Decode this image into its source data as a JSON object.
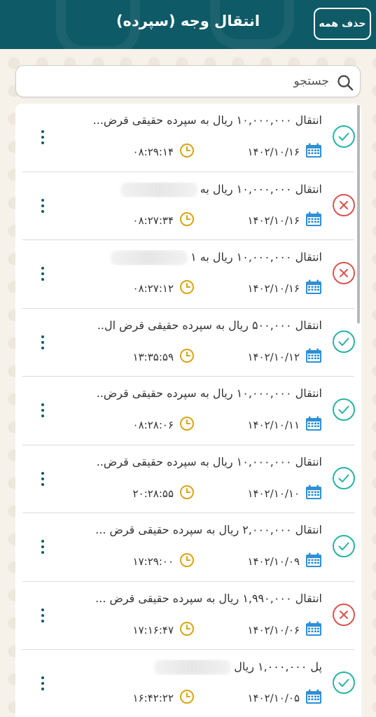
{
  "header": {
    "title": "انتقال وجه (سپرده)",
    "clear_all_label": "حذف همه"
  },
  "search": {
    "placeholder": "جستجو",
    "value": ""
  },
  "colors": {
    "header_bg": "#0e5a66",
    "success": "#27b3a4",
    "failure": "#d9534f",
    "calendar_icon": "#2f8fd6",
    "clock_icon": "#d9a514"
  },
  "transactions": [
    {
      "status": "success",
      "title": "انتقال ۱۰,۰۰۰,۰۰۰ ریال به سپرده حقیقی قرض...",
      "masked": false,
      "date": "۱۴۰۲/۱۰/۱۶",
      "time": "۰۸:۲۹:۱۴"
    },
    {
      "status": "failure",
      "title": "انتقال ۱۰,۰۰۰,۰۰۰ ریال به",
      "masked": true,
      "date": "۱۴۰۲/۱۰/۱۶",
      "time": "۰۸:۲۷:۳۴"
    },
    {
      "status": "failure",
      "title": "انتقال ۱۰,۰۰۰,۰۰۰ ریال به ۱",
      "masked": true,
      "date": "۱۴۰۲/۱۰/۱۶",
      "time": "۰۸:۲۷:۱۲"
    },
    {
      "status": "success",
      "title": "انتقال ۵۰۰,۰۰۰ ریال به سپرده حقیقی قرض ال..",
      "masked": false,
      "date": "۱۴۰۲/۱۰/۱۲",
      "time": "۱۳:۳۵:۵۹"
    },
    {
      "status": "success",
      "title": "انتقال ۱۰,۰۰۰,۰۰۰ ریال به سپرده حقیقی قرض..",
      "masked": false,
      "date": "۱۴۰۲/۱۰/۱۱",
      "time": "۰۸:۲۸:۰۶"
    },
    {
      "status": "success",
      "title": "انتقال ۱۰,۰۰۰,۰۰۰ ریال به سپرده حقیقی قرض..",
      "masked": false,
      "date": "۱۴۰۲/۱۰/۱۰",
      "time": "۲۰:۲۸:۵۵"
    },
    {
      "status": "success",
      "title": "انتقال ۲,۰۰۰,۰۰۰ ریال به سپرده حقیقی قرض ...",
      "masked": false,
      "date": "۱۴۰۲/۱۰/۰۹",
      "time": "۱۷:۲۹:۰۰"
    },
    {
      "status": "failure",
      "title": "انتقال ۱,۹۹۰,۰۰۰ ریال به سپرده حقیقی قرض ...",
      "masked": false,
      "date": "۱۴۰۲/۱۰/۰۶",
      "time": "۱۷:۱۶:۴۷"
    },
    {
      "status": "success",
      "title": "پل ۱,۰۰۰,۰۰۰ ریال",
      "masked": true,
      "date": "۱۴۰۲/۱۰/۰۵",
      "time": "۱۶:۴۲:۲۲"
    }
  ]
}
